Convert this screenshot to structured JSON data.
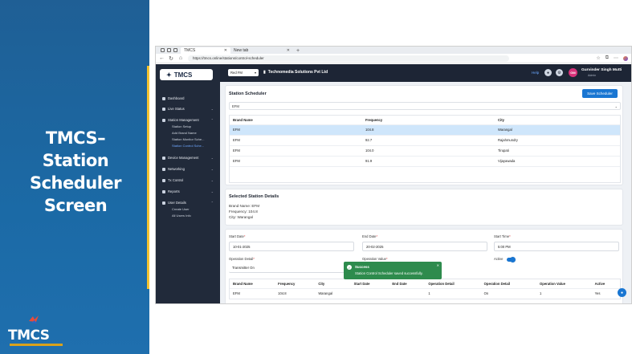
{
  "slide": {
    "title_lines": [
      "TMCS–",
      "Station",
      "Scheduler",
      "Screen"
    ],
    "logo_text": "TMCS"
  },
  "browser": {
    "tabs": [
      {
        "label": "TMCS",
        "active": true
      },
      {
        "label": "New tab",
        "active": false
      }
    ],
    "url": "https://tmcs.online/stations/control-scheduler"
  },
  "app": {
    "logo": "TMCS",
    "topbar": {
      "station_select": "Red FM",
      "company": "Technomedia Solutions Pvt Ltd",
      "help": "Help",
      "avatar_initials": "GM",
      "user_name": "Gurvinder Singh Mutti",
      "user_role": "Admin"
    },
    "sidebar": {
      "items": [
        {
          "label": "Dashboard"
        },
        {
          "label": "Live Status"
        },
        {
          "label": "Station Management"
        },
        {
          "label": "Device Management"
        },
        {
          "label": "Networking"
        },
        {
          "label": "Tx Control"
        },
        {
          "label": "Reports"
        },
        {
          "label": "User Details"
        }
      ],
      "station_sub": [
        "Station Setup",
        "Add Brand Name",
        "Station Monitor Sche...",
        "Station Control Sche..."
      ],
      "user_sub": [
        "Create User",
        "All Users Info"
      ]
    },
    "scheduler": {
      "title": "Station Scheduler",
      "save_label": "Save Scheduler",
      "dropdown_value": "EFM",
      "columns": [
        "Brand Name",
        "Frequency",
        "City"
      ],
      "rows": [
        [
          "EFM",
          "104.8",
          "Warangal"
        ],
        [
          "EFM",
          "92.7",
          "Rajahmundry"
        ],
        [
          "EFM",
          "104.0",
          "Tirupati"
        ],
        [
          "EFM",
          "91.9",
          "Vijayawada"
        ]
      ]
    },
    "selected": {
      "title": "Selected Station Details",
      "brand": "Brand Name: EFM",
      "frequency": "Frequency: 104.8",
      "city": "City: Warangal"
    },
    "form": {
      "start_date_label": "Start Date",
      "start_date": "10-01-2025",
      "end_date_label": "End Date",
      "end_date": "20-02-2025",
      "start_time_label": "Start Time",
      "start_time": "5:00 PM",
      "op_detail_label": "Operation Detail",
      "op_detail": "Transmitter On",
      "op_value_label": "Operation Value",
      "op_value": "1",
      "active_label": "Active"
    },
    "bottom_table": {
      "columns": [
        "Brand Name",
        "Frequency",
        "City",
        "Start Date",
        "End Date",
        "Operation Detail",
        "Operation Detail",
        "Operation Value",
        "Active"
      ],
      "row": [
        "EFM",
        "104.8",
        "Warangal",
        "",
        "",
        "1",
        "On",
        "1",
        "Yes"
      ]
    },
    "toast": {
      "title": "Success",
      "message": "Station Control Scheduler saved successfully."
    }
  }
}
